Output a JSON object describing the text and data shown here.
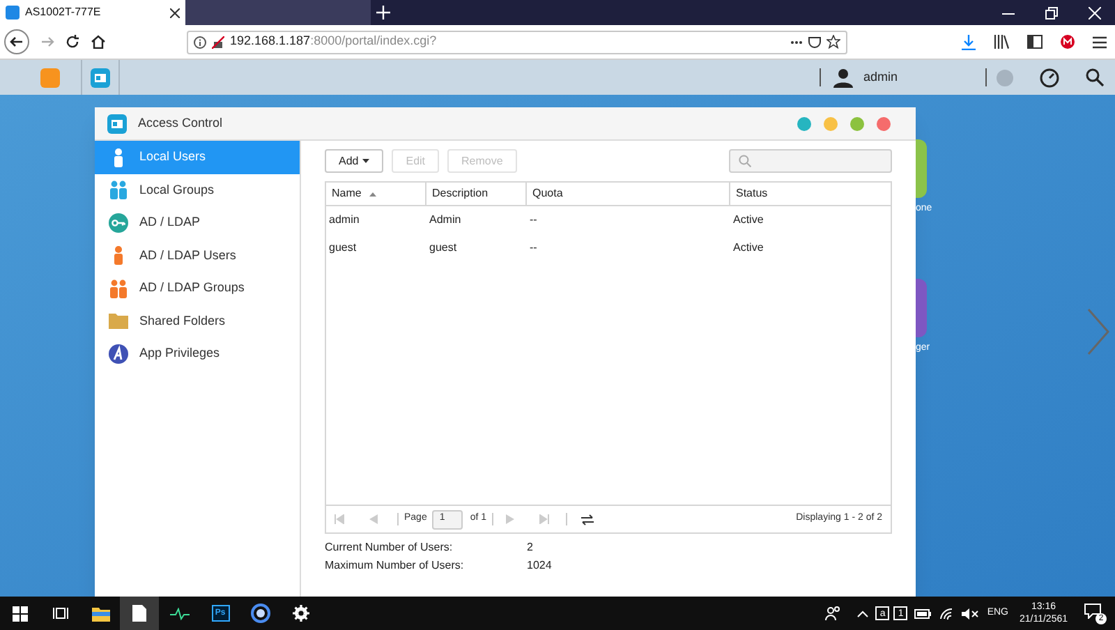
{
  "browser": {
    "tabs": [
      {
        "title": "AS1002T-777E",
        "selected": true
      }
    ],
    "url_host": "192.168.1.187",
    "url_path": ":8000/portal/index.cgi?"
  },
  "adm_bar": {
    "user": "admin"
  },
  "window": {
    "title": "Access Control"
  },
  "sidebar": {
    "items": [
      {
        "label": "Local Users",
        "kind": "user",
        "selected": true
      },
      {
        "label": "Local Groups",
        "kind": "group",
        "selected": false
      },
      {
        "label": "AD / LDAP",
        "kind": "key",
        "selected": false
      },
      {
        "label": "AD / LDAP Users",
        "kind": "aduser",
        "selected": false
      },
      {
        "label": "AD / LDAP Groups",
        "kind": "adgroup",
        "selected": false
      },
      {
        "label": "Shared Folders",
        "kind": "folder",
        "selected": false
      },
      {
        "label": "App Privileges",
        "kind": "app",
        "selected": false
      }
    ]
  },
  "toolbar": {
    "buttons": [
      {
        "label": "Add",
        "kind": "dropdown",
        "disabled": false
      },
      {
        "label": "Edit",
        "kind": "plain",
        "disabled": true
      },
      {
        "label": "Remove",
        "kind": "plain",
        "disabled": true
      }
    ]
  },
  "table": {
    "columns": [
      {
        "label": "Name",
        "sorted": true
      },
      {
        "label": "Description",
        "sorted": false
      },
      {
        "label": "Quota",
        "sorted": false
      },
      {
        "label": "Status",
        "sorted": false
      }
    ],
    "rows": [
      [
        "admin",
        "Admin",
        "--",
        "Active"
      ],
      [
        "guest",
        "guest",
        "--",
        "Active"
      ]
    ]
  },
  "pagination": {
    "page_label": "Page",
    "page_value": "1",
    "of_label": "of 1",
    "displaying": "Displaying 1 - 2 of 2"
  },
  "summary": [
    {
      "label": "Current Number of Users:",
      "value": "2"
    },
    {
      "label": "Maximum Number of Users:",
      "value": "1024"
    }
  ],
  "desktop_icons": [
    {
      "label": "one",
      "color": "#8bc34a"
    },
    {
      "label": "ger",
      "color": "#7e57c2"
    }
  ],
  "taskbar": {
    "ps_label": "Ps",
    "tray_keys": [
      "a",
      "1"
    ],
    "language": "ENG",
    "time": "13:16",
    "date": "21/11/2561",
    "notification_count": "2"
  }
}
